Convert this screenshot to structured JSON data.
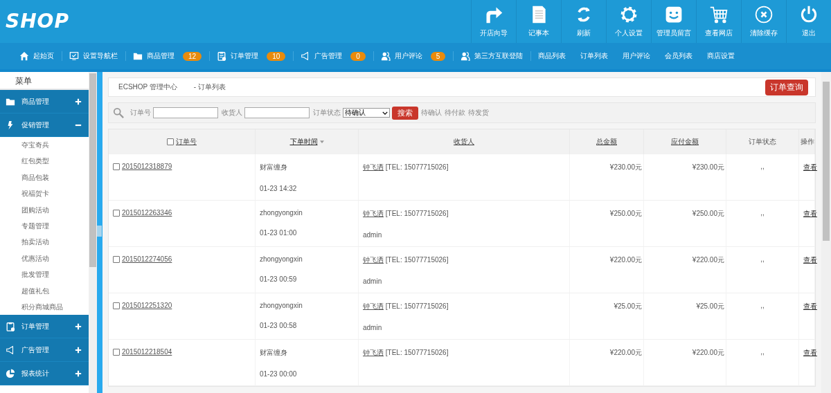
{
  "header": {
    "logo": "SHOP",
    "tools": [
      {
        "label": "开店向导"
      },
      {
        "label": "记事本"
      },
      {
        "label": "刷新"
      },
      {
        "label": "个人设置"
      },
      {
        "label": "管理员留言"
      },
      {
        "label": "查看网店"
      },
      {
        "label": "清除缓存"
      },
      {
        "label": "退出"
      }
    ]
  },
  "nav": [
    {
      "label": "起始页"
    },
    {
      "label": "设置导航栏"
    },
    {
      "label": "商品管理",
      "badge": "12"
    },
    {
      "label": "订单管理",
      "badge": "10"
    },
    {
      "label": "广告管理",
      "badge": "0"
    },
    {
      "label": "用户评论",
      "badge": "5"
    },
    {
      "label": "第三方互联登陆"
    },
    {
      "label": "商品列表"
    },
    {
      "label": "订单列表"
    },
    {
      "label": "用户评论"
    },
    {
      "label": "会员列表"
    },
    {
      "label": "商店设置"
    }
  ],
  "sidebar": {
    "title": "菜单",
    "groups": [
      {
        "label": "商品管理",
        "expanded": false
      },
      {
        "label": "促销管理",
        "expanded": true,
        "children": [
          "夺宝奇兵",
          "红包类型",
          "商品包装",
          "祝福贺卡",
          "团购活动",
          "专题管理",
          "拍卖活动",
          "优惠活动",
          "批发管理",
          "超值礼包",
          "积分商城商品"
        ]
      },
      {
        "label": "订单管理",
        "expanded": false
      },
      {
        "label": "广告管理",
        "expanded": false
      },
      {
        "label": "报表统计",
        "expanded": false
      }
    ]
  },
  "breadcrumb": {
    "root": "ECSHOP 管理中心",
    "page": "- 订单列表",
    "action": "订单查询"
  },
  "search": {
    "fields": [
      {
        "label": "订单号"
      },
      {
        "label": "收货人"
      }
    ],
    "status_label": "订单状态",
    "status_value": "待确认",
    "button": "搜索",
    "quick_filters": [
      "待确认",
      "待付款",
      "待发货"
    ]
  },
  "table": {
    "select_all": false,
    "columns": [
      {
        "label": "订单号",
        "link": true,
        "sorted": false
      },
      {
        "label": "下单时间",
        "link": true,
        "sorted": true
      },
      {
        "label": "收货人",
        "link": true,
        "sorted": false
      },
      {
        "label": "总金额",
        "link": true,
        "sorted": false
      },
      {
        "label": "应付金额",
        "link": true,
        "sorted": false
      },
      {
        "label": "订单状态",
        "link": false,
        "sorted": false
      },
      {
        "label": "操作",
        "link": false,
        "sorted": false
      }
    ],
    "rows": [
      {
        "selected": false,
        "order_no": "2015012318879",
        "buyer": "财富缠身",
        "time": "01-23 14:32",
        "consignee": "钟飞洒",
        "tel": "[TEL: 15077715026]",
        "total": "¥230.00元",
        "payable": "¥230.00元",
        "status": ",,",
        "action": "查看"
      },
      {
        "selected": false,
        "order_no": "2015012263346",
        "buyer": "zhongyongxin",
        "time": "01-23 01:00",
        "consignee": "钟飞洒",
        "tel": "[TEL: 15077715026]",
        "note": "admin",
        "total": "¥250.00元",
        "payable": "¥250.00元",
        "status": ",,",
        "action": "查看"
      },
      {
        "selected": false,
        "order_no": "2015012274056",
        "buyer": "zhongyongxin",
        "time": "01-23 00:59",
        "consignee": "钟飞洒",
        "tel": "[TEL: 15077715026]",
        "note": "admin",
        "total": "¥220.00元",
        "payable": "¥220.00元",
        "status": ",,",
        "action": "查看"
      },
      {
        "selected": false,
        "order_no": "2015012251320",
        "buyer": "zhongyongxin",
        "time": "01-23 00:58",
        "consignee": "钟飞洒",
        "tel": "[TEL: 15077715026]",
        "note": "admin",
        "total": "¥25.00元",
        "payable": "¥25.00元",
        "status": ",,",
        "action": "查看"
      },
      {
        "selected": false,
        "order_no": "2015012218504",
        "buyer": "财富缠身",
        "time": "01-23 00:00",
        "consignee": "钟飞洒",
        "tel": "[TEL: 15077715026]",
        "total": "¥220.00元",
        "payable": "¥220.00元",
        "status": ",,",
        "action": "查看"
      }
    ]
  }
}
